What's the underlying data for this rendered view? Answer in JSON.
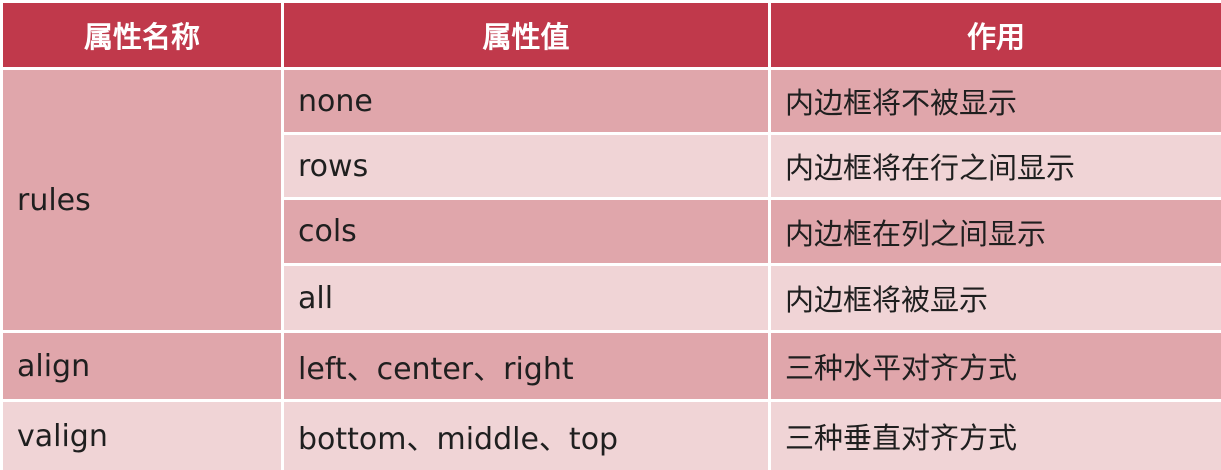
{
  "table": {
    "headers": [
      "属性名称",
      "属性值",
      "作用"
    ],
    "rules_group": {
      "name": "rules",
      "rows": [
        {
          "value": "none",
          "effect": "内边框将不被显示"
        },
        {
          "value": "rows",
          "effect": "内边框将在行之间显示"
        },
        {
          "value": "cols",
          "effect": "内边框在列之间显示"
        },
        {
          "value": "all",
          "effect": "内边框将被显示"
        }
      ]
    },
    "rows": [
      {
        "name": "align",
        "value": "left、center、right",
        "effect": "三种水平对齐方式"
      },
      {
        "name": "valign",
        "value": "bottom、middle、top",
        "effect": "三种垂直对齐方式"
      }
    ]
  },
  "colors": {
    "header_bg": "#c0394b",
    "row_dark": "#e0a6ab",
    "row_light": "#f0d4d6",
    "border": "#ffffff"
  }
}
